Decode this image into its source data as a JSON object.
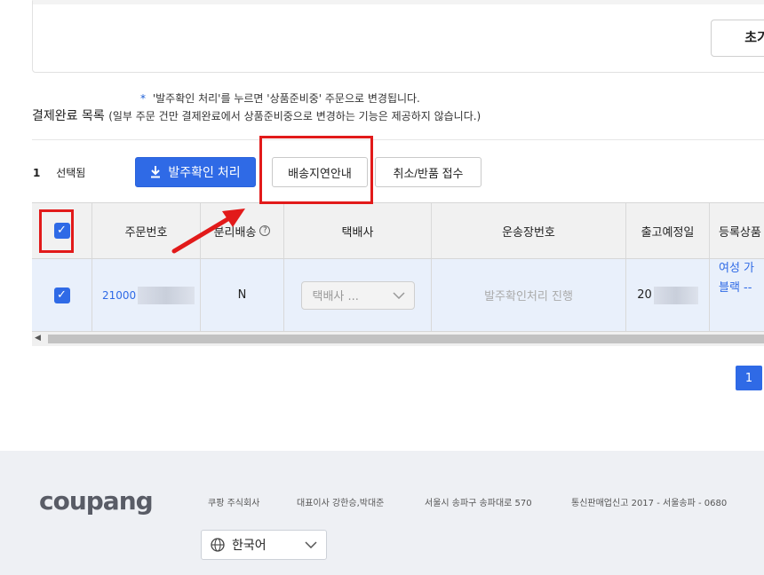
{
  "filter": {
    "reset_label": "초기"
  },
  "notice": {
    "star": "*",
    "text": "'발주확인 처리'를 누르면 '상품준비중' 주문으로 변경됩니다."
  },
  "list": {
    "title": "결제완료 목록",
    "subtitle": "(일부 주문 건만 결제완료에서 상품준비중으로 변경하는 기능은 제공하지 않습니다.)"
  },
  "selection": {
    "count": "1",
    "label": "선택됨"
  },
  "toolbar": {
    "confirm_label": "발주확인 처리",
    "delay_label": "배송지연안내",
    "cancel_label": "취소/반품 접수"
  },
  "table": {
    "headers": [
      "주문번호",
      "분리배송",
      "택배사",
      "운송장번호",
      "출고예정일",
      "등록상품"
    ],
    "row": {
      "order_no": "21000",
      "split": "N",
      "courier_select": "택배사 ...",
      "tracking_placeholder": "발주확인처리 진행",
      "ship_date": "20",
      "product_line1": "여성 가",
      "product_line2": "블랙 --"
    }
  },
  "pagination": {
    "current": "1"
  },
  "footer": {
    "logo": "coupang",
    "company": "쿠팡 주식회사",
    "ceo": "대표이사 강한승,박대준",
    "address": "서울시 송파구 송파대로 570",
    "license": "통신판매업신고 2017 - 서울송파 - 0680",
    "language": "한국어"
  },
  "colors": {
    "accent": "#2f6ae6",
    "highlight": "#e21a1a"
  }
}
